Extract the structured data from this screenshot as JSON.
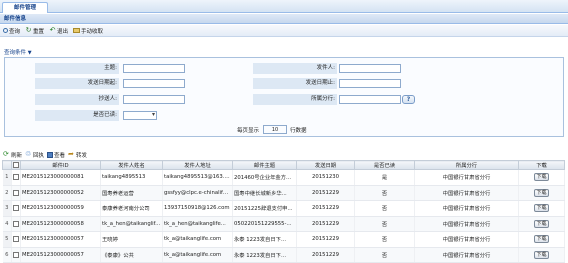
{
  "tab": {
    "label": "邮件管理"
  },
  "panel": {
    "title": "邮件信息"
  },
  "toolbar": {
    "query": "查询",
    "reset": "重置",
    "back": "退出",
    "receive": "手动收取"
  },
  "query": {
    "section_title": "查询条件",
    "labels": {
      "subject": "主题:",
      "sender": "发件人:",
      "send_date_from": "发送日期起:",
      "send_date_to": "发送日期止:",
      "cc": "抄送人:",
      "branch": "所属分行:",
      "read": "是否已读:"
    },
    "help_button": "?",
    "page_size_prefix": "每页显示",
    "page_size_value": "10",
    "page_size_suffix": "行数据"
  },
  "grid_toolbar": {
    "refresh": "刷新",
    "recycle": "回执",
    "view": "查看",
    "forward": "转发"
  },
  "grid": {
    "headers": [
      "",
      "",
      "邮件ID",
      "发件人姓名",
      "发件人地址",
      "邮件主题",
      "发送日期",
      "是否已读",
      "所属分行",
      "下载"
    ],
    "rows": [
      {
        "num": "1",
        "id": "ME2015123000000081",
        "name": "taikang4895513",
        "addr": "taikang4895513@163.com",
        "subject": "201460号企业年金方...",
        "date": "20151230",
        "read": "是",
        "branch": "中国银行甘肃省分行",
        "dl": "下载"
      },
      {
        "num": "2",
        "id": "ME2015123000000052",
        "name": "国寿养老运营",
        "addr": "gssfyy@clpc.e-chinalife.c...",
        "subject": "国寿中继长城新乡华...",
        "date": "20151229",
        "read": "否",
        "branch": "中国银行甘肃省分行",
        "dl": "下载"
      },
      {
        "num": "3",
        "id": "ME2015123000000059",
        "name": "泰康养老河南分公司",
        "addr": "13937150918@126.com",
        "subject": "20151225辞退支付申...",
        "date": "20151229",
        "read": "否",
        "branch": "中国银行甘肃省分行",
        "dl": "下载"
      },
      {
        "num": "4",
        "id": "ME2015123000000058",
        "name": "tk_a_hen@taikanglif...",
        "addr": "tk_a_hen@taikanglife...",
        "subject": "050220151229555-...",
        "date": "20151229",
        "read": "否",
        "branch": "中国银行甘肃省分行",
        "dl": "下载"
      },
      {
        "num": "5",
        "id": "ME2015123000000057",
        "name": "王晓婷",
        "addr": "tk_a@taikanglife.com",
        "subject": "永泰 1223发自日下...",
        "date": "20151229",
        "read": "否",
        "branch": "中国银行甘肃省分行",
        "dl": "下载"
      },
      {
        "num": "6",
        "id": "ME2015123000000057",
        "name": "《泰康》公共",
        "addr": "tk_a@taikanglife.com",
        "subject": "永泰 1223发自日下...",
        "date": "20151229",
        "read": "否",
        "branch": "中国银行甘肃省分行",
        "dl": "下载"
      }
    ]
  }
}
